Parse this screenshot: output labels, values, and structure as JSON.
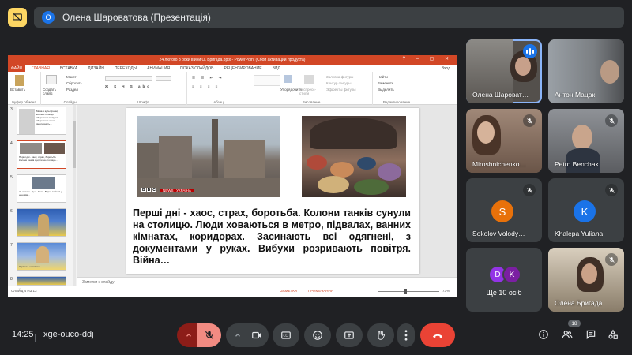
{
  "header": {
    "presenter_initial": "О",
    "presenter_title": "Олена Шароватова (Презентація)"
  },
  "powerpoint": {
    "window_title": "24 лютого 3 роки війни О. Бригада.pptx - PowerPoint (Сбой активации продукта)",
    "tabs": [
      "ФАЙЛ",
      "ГЛАВНАЯ",
      "ВСТАВКА",
      "ДИЗАЙН",
      "ПЕРЕХОДЫ",
      "АНИМАЦИЯ",
      "ПОКАЗ СЛАЙДОВ",
      "РЕЦЕНЗИРОВАНИЕ",
      "ВИД"
    ],
    "user": "Вход",
    "ribbon": {
      "paste": "Вставить",
      "layout": "Макет",
      "reset": "Сбросить",
      "section": "Раздел",
      "new_slide": "Создать слайд",
      "clipboard": "Буфер обмена",
      "slides": "Слайды",
      "font": "Шрифт",
      "paragraph": "Абзац",
      "arrange": "Упорядочить",
      "quick_styles": "Экспресс-стили",
      "shape_fill": "Заливка фигуры",
      "shape_outline": "Контур фигуры",
      "shape_effects": "Эффекты фигуры",
      "drawing": "Рисование",
      "find": "Найти",
      "replace": "Заменить",
      "select": "Выделить",
      "editing": "Редактирование"
    },
    "thumbnails": [
      {
        "num": "3",
        "text": "Мова в культурному контексті. Якщо збережемо мову, ми збережемо свою ідентичність..."
      },
      {
        "num": "4",
        "text": "Перші дні - хаос, страх, боротьба. Колони танків сунули на столицю..."
      },
      {
        "num": "5",
        "text": "24 лютого - день болю. Ворог зайшов у наш дім..."
      },
      {
        "num": "6",
        "text": ""
      },
      {
        "num": "7",
        "text": "Україна - незламна..."
      },
      {
        "num": "8",
        "text": ""
      }
    ],
    "slide": {
      "bbc_letters": [
        "B",
        "B",
        "C"
      ],
      "bbc_bar": "NEWS | УКРАЇНА",
      "text": "Перші дні - хаос, страх, боротьба. Колони танків сунули на столицю. Люди ховаються в метро, підвалах, ванних кімнатах, коридорах. Засинають всі одягнені, з документами у руках. Вибухи розривають повітря. Війна…"
    },
    "notes_placeholder": "Заметки к слайду",
    "status": {
      "slide_counter": "СЛАЙД 4 ИЗ 13",
      "notes": "ЗАМЕТКИ",
      "comments": "ПРИМЕЧАНИЯ",
      "zoom": "73%"
    }
  },
  "participants": [
    {
      "name": "Олена Шароват…",
      "speaking": true
    },
    {
      "name": "Антон Мацак",
      "muted": false
    },
    {
      "name": "Miroshnichenko…",
      "muted": true
    },
    {
      "name": "Petro Benchak",
      "muted": true
    },
    {
      "name": "Sokolov Volody…",
      "initial": "S",
      "color": "#e8710a",
      "muted": true
    },
    {
      "name": "Khalepa Yuliana",
      "initial": "K",
      "color": "#1a73e8",
      "muted": true
    },
    {
      "name": "Ще 10 осіб",
      "initials": [
        "D",
        "K"
      ]
    },
    {
      "name": "Олена Бригада",
      "muted": true
    }
  ],
  "bottom": {
    "time": "14:25",
    "meeting_code": "xge-ouco-ddj",
    "people_count": "18"
  }
}
